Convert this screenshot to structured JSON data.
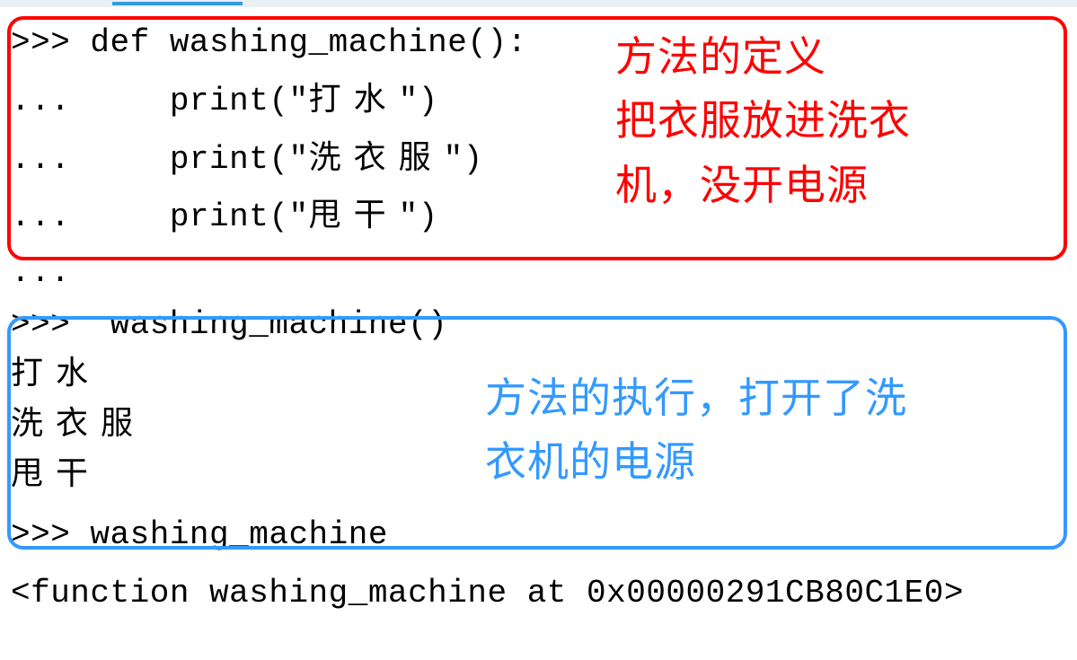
{
  "definition": {
    "line1": ">>> def washing_machine():",
    "line2": "...     print(\"打水\")",
    "line3": "...     print(\"洗衣服\")",
    "line4": "...     print(\"甩干\")"
  },
  "mid": {
    "line1": "..."
  },
  "execution": {
    "line1": ">>>  washing_machine()",
    "out1": "打水",
    "out2": "洗衣服",
    "out3": "甩干"
  },
  "reference": {
    "line1": ">>> washing_machine",
    "line2": "<function washing_machine at 0x00000291CB80C1E0>"
  },
  "annotations": {
    "red_line1": "方法的定义",
    "red_line2": "把衣服放进洗衣",
    "red_line3": "机，没开电源",
    "blue_line1": "方法的执行，打开了洗",
    "blue_line2": "衣机的电源"
  }
}
